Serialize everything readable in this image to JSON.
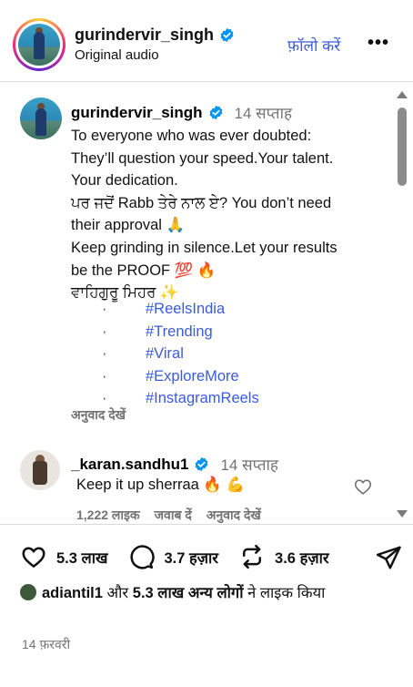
{
  "header": {
    "username": "gurindervir_singh",
    "subtitle": "Original audio",
    "follow_label": "फ़ॉलो करें",
    "more_label": "•••"
  },
  "caption": {
    "username": "gurindervir_singh",
    "time": "14 सप्ताह",
    "lines": [
      "To everyone who was ever doubted:",
      "They’ll question your speed.Your talent.",
      "Your dedication.",
      "ਪਰ ਜਦੋਂ Rabb ਤੇਰੇ ਨਾਲ ਏ? You don’t need",
      "their approval 🙏",
      "Keep grinding in silence.Let your results",
      "be the PROOF 💯 🔥",
      "ਵਾਹਿਗੁਰੂ ਮਿਹਰ ✨"
    ],
    "bullet": "·",
    "hashtags": [
      "#ReelsIndia",
      "#Trending",
      "#Viral",
      "#ExploreMore",
      "#InstagramReels"
    ],
    "translate_label": "अनुवाद देखें"
  },
  "comment": {
    "username": "_karan.sandhu1",
    "time": "14 सप्ताह",
    "text": "Keep it up sherraa 🔥 💪",
    "likes": "1,222 लाइक",
    "reply_label": "जवाब दें",
    "translate_label": "अनुवाद देखें"
  },
  "actions": {
    "likes_count": "5.3 लाख",
    "comments_count": "3.7 हज़ार",
    "reposts_count": "3.6 हज़ार"
  },
  "liked_by": {
    "user": "adiantil1",
    "connector": "और",
    "others": "5.3 लाख अन्य लोगों",
    "suffix": "ने लाइक किया"
  },
  "post_date": "14 फ़रवरी",
  "colors": {
    "link_blue": "#3b5bdb",
    "muted_gray": "#737373",
    "verified_blue": "#0095f6"
  }
}
